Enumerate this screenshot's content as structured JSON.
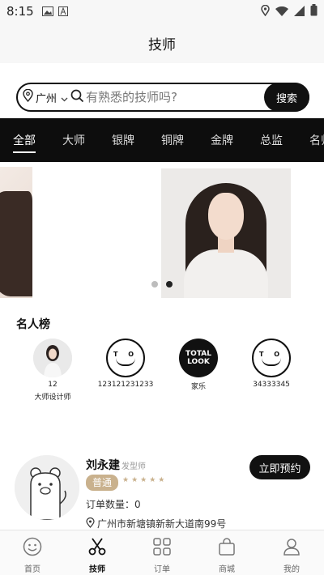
{
  "status_bar": {
    "time": "8:15"
  },
  "header": {
    "title": "技师"
  },
  "search": {
    "city": "广州",
    "placeholder": "有熟悉的技师吗?",
    "button_label": "搜索"
  },
  "tabs": [
    {
      "label": "全部",
      "active": true
    },
    {
      "label": "大师"
    },
    {
      "label": "银牌"
    },
    {
      "label": "铜牌"
    },
    {
      "label": "金牌"
    },
    {
      "label": "总监"
    },
    {
      "label": "名师"
    }
  ],
  "banner": {
    "slide_count": 2,
    "active_slide": 2
  },
  "celebrity_section": {
    "title": "名人榜",
    "items": [
      {
        "count": "12",
        "role": "大师设计师"
      },
      {
        "count": "123121231233"
      },
      {
        "count": "家乐",
        "logo_text": [
          "TOTAL",
          "LOOK"
        ]
      },
      {
        "count": "34333345"
      }
    ],
    "to_logo_text": "T O"
  },
  "stylist_card": {
    "name": "刘永建",
    "title": "发型师",
    "level": "普通",
    "stars": "★★★★★",
    "order_count": "订单数量：0",
    "address": "广州市新塘镇新新大道南99号",
    "book_label": "立即预约"
  },
  "bottom_nav": [
    {
      "label": "首页",
      "icon": "smile-face-icon"
    },
    {
      "label": "技师",
      "icon": "scissors-icon",
      "active": true
    },
    {
      "label": "订单",
      "icon": "grid-icon"
    },
    {
      "label": "商城",
      "icon": "shopping-bag-icon"
    },
    {
      "label": "我的",
      "icon": "user-icon"
    }
  ],
  "colors": {
    "accent_gold": "#c9b18d",
    "dark": "#111111"
  }
}
